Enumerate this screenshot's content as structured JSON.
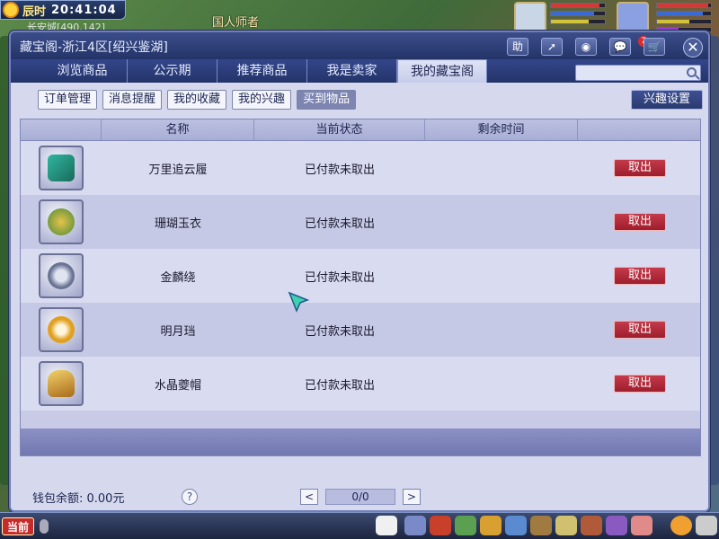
{
  "hud": {
    "period": "辰时",
    "time": "20:41:04",
    "coord": "长安城[490,142]",
    "npc": "国人师者"
  },
  "window": {
    "title": "藏宝阁-浙江4区[绍兴鉴湖]",
    "help_label": "助",
    "badge_count": "7"
  },
  "tabs": [
    {
      "label": "浏览商品"
    },
    {
      "label": "公示期"
    },
    {
      "label": "推荐商品"
    },
    {
      "label": "我是卖家"
    },
    {
      "label": "我的藏宝阁"
    }
  ],
  "subnav": [
    {
      "label": "订单管理"
    },
    {
      "label": "消息提醒"
    },
    {
      "label": "我的收藏"
    },
    {
      "label": "我的兴趣"
    },
    {
      "label": "买到物品"
    }
  ],
  "interest_settings": "兴趣设置",
  "table": {
    "headers": [
      "名称",
      "当前状态",
      "剩余时间"
    ],
    "rows": [
      {
        "name": "万里追云履",
        "status": "已付款未取出",
        "remaining": "",
        "action": "取出",
        "icon": "boots-icon"
      },
      {
        "name": "珊瑚玉衣",
        "status": "已付款未取出",
        "remaining": "",
        "action": "取出",
        "icon": "armor-icon"
      },
      {
        "name": "金麟绕",
        "status": "已付款未取出",
        "remaining": "",
        "action": "取出",
        "icon": "ring-icon"
      },
      {
        "name": "明月珰",
        "status": "已付款未取出",
        "remaining": "",
        "action": "取出",
        "icon": "earring-icon"
      },
      {
        "name": "水晶夔帽",
        "status": "已付款未取出",
        "remaining": "",
        "action": "取出",
        "icon": "helmet-icon"
      }
    ]
  },
  "footer": {
    "wallet": "钱包余额: 0.00元",
    "help": "?",
    "page": "0/0",
    "prev": "<",
    "next": ">"
  },
  "bottom_bar": {
    "chat_channel": "当前"
  },
  "colors": {
    "accent": "#2a3a70",
    "take_button": "#b02a3a",
    "panel": "#d6d9ee"
  }
}
